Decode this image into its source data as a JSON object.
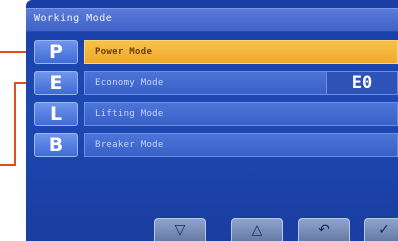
{
  "title": "Working Mode",
  "modes": [
    {
      "key": "P",
      "label": "Power Mode",
      "value": ""
    },
    {
      "key": "E",
      "label": "Economy Mode",
      "value": "E0"
    },
    {
      "key": "L",
      "label": "Lifting Mode",
      "value": ""
    },
    {
      "key": "B",
      "label": "Breaker Mode",
      "value": ""
    }
  ],
  "active_mode": "Power Mode",
  "nav": {
    "down_icon": "▽",
    "up_icon": "△",
    "back_icon": "↶",
    "confirm_icon": "✓"
  },
  "colors": {
    "screen_bg": "#1d49b3",
    "highlight": "#f0a92a",
    "callout": "#e0501e"
  }
}
